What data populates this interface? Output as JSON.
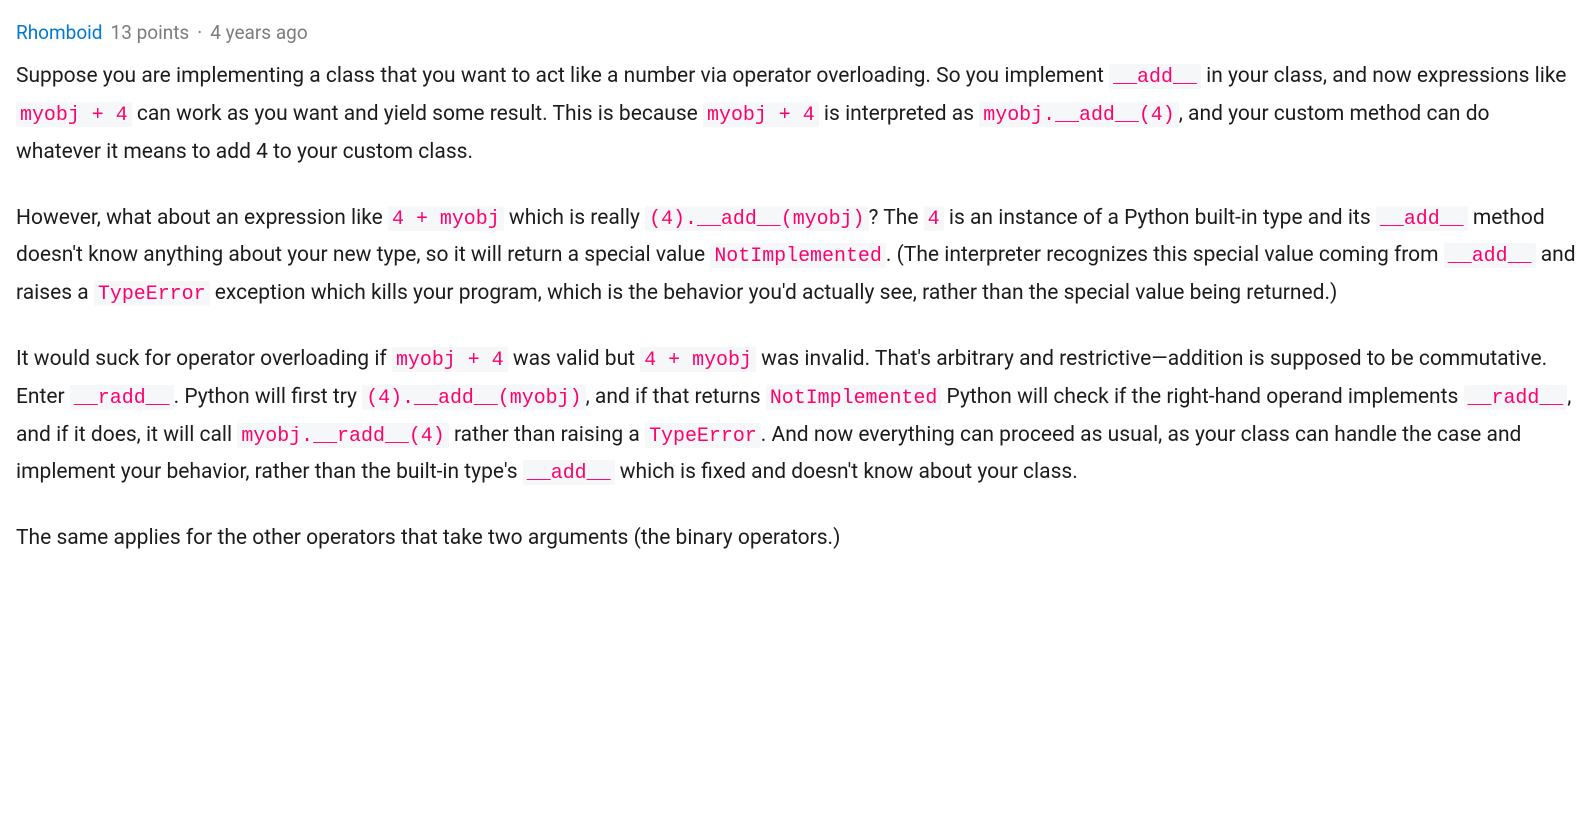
{
  "comment": {
    "username": "Rhomboid",
    "points": "13 points",
    "separator": "·",
    "timestamp": "4 years ago",
    "paragraphs": {
      "p1": {
        "t1": "Suppose you are implementing a class that you want to act like a number via operator overloading. So you implement ",
        "c1": "__add__",
        "t2": " in your class, and now expressions like ",
        "c2": "myobj + 4",
        "t3": " can work as you want and yield some result. This is because ",
        "c3": "myobj + 4",
        "t4": " is interpreted as ",
        "c4": "myobj.__add__(4)",
        "t5": ", and your custom method can do whatever it means to add 4 to your custom class."
      },
      "p2": {
        "t1": "However, what about an expression like ",
        "c1": "4 + myobj",
        "t2": " which is really ",
        "c2": "(4).__add__(myobj)",
        "t3": "? The ",
        "c3": "4",
        "t4": " is an instance of a Python built-in type and its ",
        "c4": "__add__",
        "t5": " method doesn't know anything about your new type, so it will return a special value ",
        "c5": "NotImplemented",
        "t6": ". (The interpreter recognizes this special value coming from ",
        "c6": "__add__",
        "t7": " and raises a ",
        "c7": "TypeError",
        "t8": " exception which kills your program, which is the behavior you'd actually see, rather than the special value being returned.)"
      },
      "p3": {
        "t1": "It would suck for operator overloading if ",
        "c1": "myobj + 4",
        "t2": " was valid but ",
        "c2": "4 + myobj",
        "t3": " was invalid. That's arbitrary and restrictive—addition is supposed to be commutative. Enter ",
        "c3": "__radd__",
        "t4": ". Python will first try ",
        "c4": "(4).__add__(myobj)",
        "t5": ", and if that returns ",
        "c5": "NotImplemented",
        "t6": " Python will check if the right-hand operand implements ",
        "c6": "__radd__",
        "t7": ", and if it does, it will call ",
        "c7": "myobj.__radd__(4)",
        "t8": " rather than raising a ",
        "c8": "TypeError",
        "t9": ". And now everything can proceed as usual, as your class can handle the case and implement your behavior, rather than the built-in type's ",
        "c9": "__add__",
        "t10": " which is fixed and doesn't know about your class."
      },
      "p4": {
        "t1": "The same applies for the other operators that take two arguments (the binary operators.)"
      }
    }
  }
}
